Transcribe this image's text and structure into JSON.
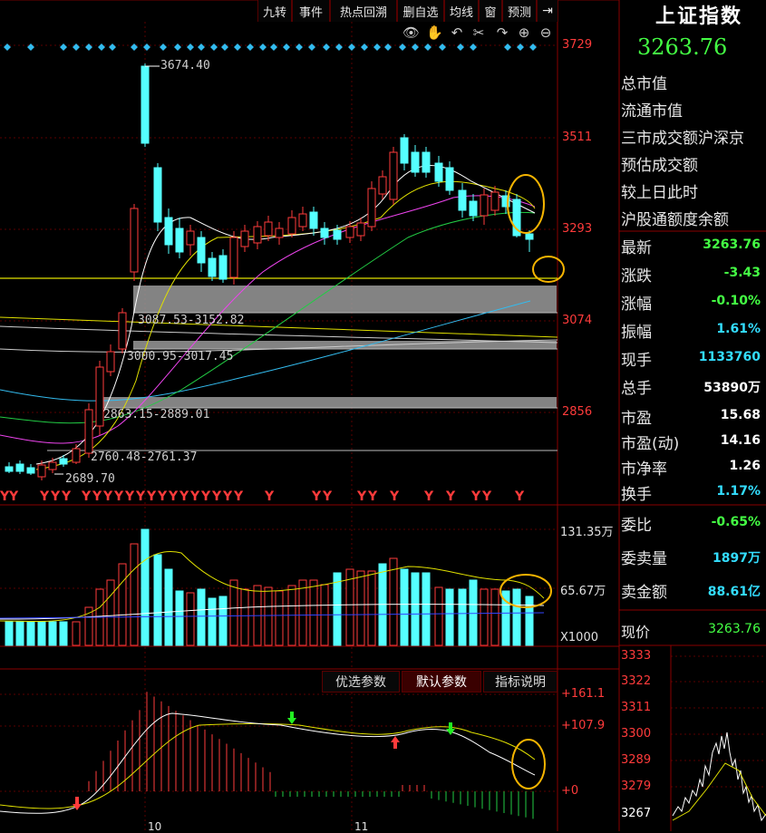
{
  "toolbar": {
    "buttons": [
      "九转",
      "事件",
      "热点回溯",
      "删自选",
      "均线",
      "窗",
      "预测"
    ],
    "pin_icon": "pin-icon"
  },
  "chart_tools": [
    "eye-icon",
    "hand-icon",
    "undo-icon",
    "scissors-icon",
    "zoom-in-icon",
    "zoom-out-icon"
  ],
  "main_chart": {
    "price_labels": [
      "3729",
      "3511",
      "3293",
      "3074",
      "2856"
    ],
    "annotations": {
      "high": "3674.40",
      "low": "2689.70",
      "zone1": "3087.53-3152.82",
      "zone2": "3000.95-3017.45",
      "zone3": "2863.15-2889.01",
      "zone4": "2760.48-2761.37"
    },
    "y_marker": "Y"
  },
  "volume_chart": {
    "labels": [
      "131.35万",
      "65.67万",
      "X1000"
    ]
  },
  "indicator": {
    "tabs": [
      "优选参数",
      "默认参数",
      "指标说明"
    ],
    "labels": [
      "+161.1",
      "+107.9",
      "+0"
    ],
    "date_labels": [
      "10",
      "11"
    ]
  },
  "quote": {
    "name": "上证指数",
    "price": "3263.76",
    "rows": [
      {
        "label": "总市值",
        "value": ""
      },
      {
        "label": "流通市值",
        "value": ""
      },
      {
        "label": "三市成交额沪深京",
        "value": ""
      },
      {
        "label": "预估成交额",
        "value": ""
      },
      {
        "label": "较上日此时",
        "value": ""
      },
      {
        "label": "沪股通额度余额",
        "value": ""
      }
    ],
    "stats": [
      {
        "label": "最新",
        "value": "3263.76",
        "color": "#44ff44"
      },
      {
        "label": "涨跌",
        "value": "-3.43",
        "color": "#44ff44"
      },
      {
        "label": "涨幅",
        "value": "-0.10%",
        "color": "#44ff44"
      },
      {
        "label": "振幅",
        "value": "1.61%",
        "color": "#33ddff"
      },
      {
        "label": "现手",
        "value": "1133760",
        "color": "#33ddff"
      },
      {
        "label": "总手",
        "value": "53890万",
        "color": "#ffffff"
      }
    ],
    "valuation": [
      {
        "label": "市盈",
        "value": "15.68"
      },
      {
        "label": "市盈(动)",
        "value": "14.16"
      },
      {
        "label": "市净率",
        "value": "1.26"
      },
      {
        "label": "换手",
        "value": "1.17%"
      }
    ],
    "order": [
      {
        "label": "委比",
        "value": "-0.65%",
        "color": "#44ff44"
      },
      {
        "label": "委卖量",
        "value": "1897万",
        "color": "#33ddff"
      },
      {
        "label": "卖金额",
        "value": "88.61亿",
        "color": "#33ddff"
      }
    ],
    "current_label": "现价",
    "current_value": "3263.76",
    "mini_axis": [
      "3333",
      "3322",
      "3311",
      "3300",
      "3289",
      "3279",
      "3267"
    ]
  }
}
